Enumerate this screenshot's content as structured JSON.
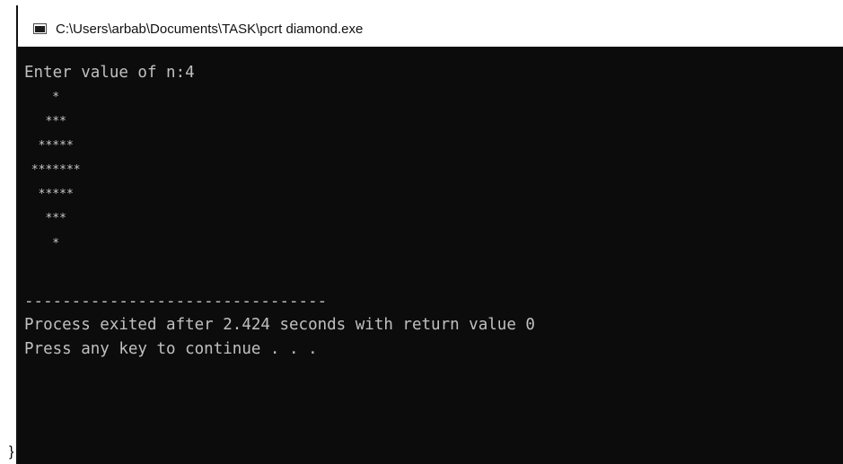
{
  "window": {
    "title": "C:\\Users\\arbab\\Documents\\TASK\\pcrt diamond.exe",
    "icon": "console-app-icon"
  },
  "console": {
    "prompt_line": "Enter value of n:4",
    "diamond": [
      "    *",
      "   ***",
      "  *****",
      " *******",
      "  *****",
      "   ***",
      "    *"
    ],
    "separator": "--------------------------------",
    "exit_line": "Process exited after 2.424 seconds with return value 0",
    "continue_line": "Press any key to continue . . ."
  },
  "stray_text": "}",
  "colors": {
    "console_background": "#0c0c0c",
    "console_text": "#c0c0c0",
    "titlebar_background": "#ffffff"
  }
}
